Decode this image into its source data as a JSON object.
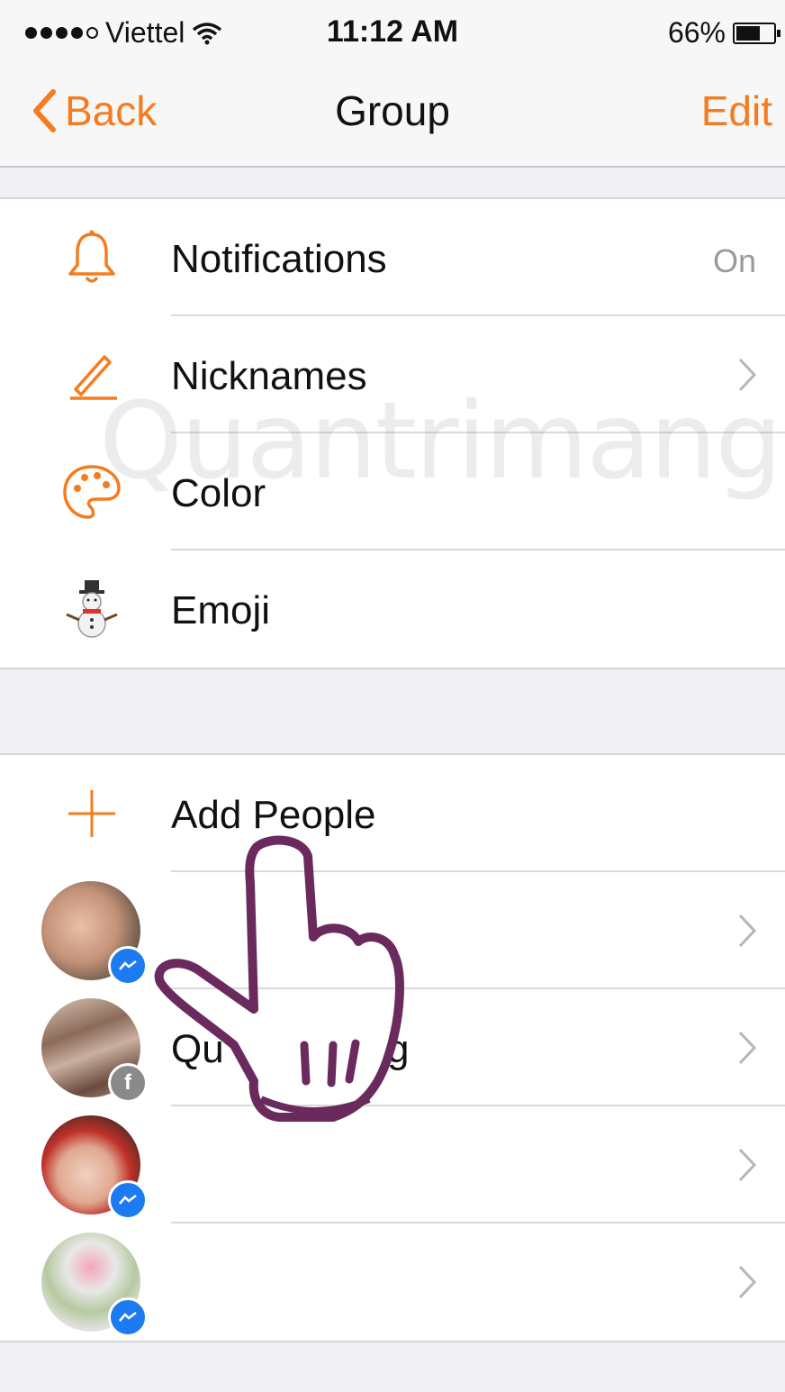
{
  "status_bar": {
    "carrier": "Viettel",
    "time": "11:12 AM",
    "battery": "66%"
  },
  "nav": {
    "back_label": "Back",
    "title": "Group",
    "edit_label": "Edit"
  },
  "settings": {
    "notifications": {
      "label": "Notifications",
      "value": "On",
      "icon": "bell-icon"
    },
    "nicknames": {
      "label": "Nicknames",
      "icon": "pencil-icon"
    },
    "color": {
      "label": "Color",
      "icon": "palette-icon"
    },
    "emoji": {
      "label": "Emoji",
      "icon": "snowman-icon"
    }
  },
  "people": {
    "add_label": "Add People",
    "members": [
      {
        "name": "",
        "badge": "messenger-icon"
      },
      {
        "name": "Qu",
        "name_end": "g",
        "badge": "facebook-icon"
      },
      {
        "name": "",
        "badge": "messenger-icon"
      },
      {
        "name": "",
        "badge": "messenger-icon"
      }
    ]
  },
  "watermark": "Quantrimang",
  "colors": {
    "accent": "#f57b1f",
    "messenger_blue": "#1d7bf2",
    "background": "#efeff4"
  }
}
